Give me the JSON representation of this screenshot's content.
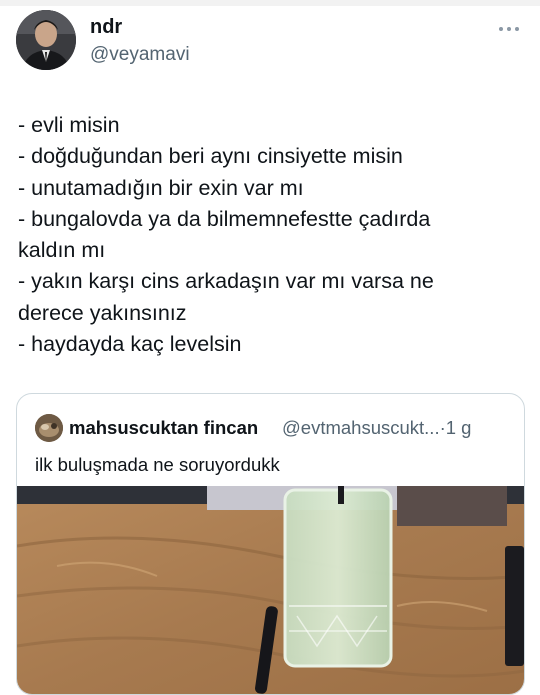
{
  "author": {
    "display_name": "ndr",
    "handle": "@veyamavi",
    "more_icon": "more-dots-icon"
  },
  "tweet": {
    "lines": [
      "- evli misin",
      "- doğduğundan beri aynı cinsiyette misin",
      "- unutamadığın bir exin var mı",
      "- bungalovda ya da bilmemnefestte çadırda",
      "kaldın mı",
      "- yakın karşı cins arkadaşın var mı varsa ne",
      "derece yakınsınız",
      "- haydayda kaç levelsin"
    ]
  },
  "quote": {
    "display_name": "mahsuscuktan fincan",
    "handle_time": "@evtmahsuscukt...·1 g",
    "text": "ilk buluşmada ne soruyordukk",
    "media": "photo of a glass of green drink with a black straw on a wooden table"
  },
  "colors": {
    "text": "#0f1419",
    "secondary": "#536471",
    "border": "#cfd9de"
  }
}
